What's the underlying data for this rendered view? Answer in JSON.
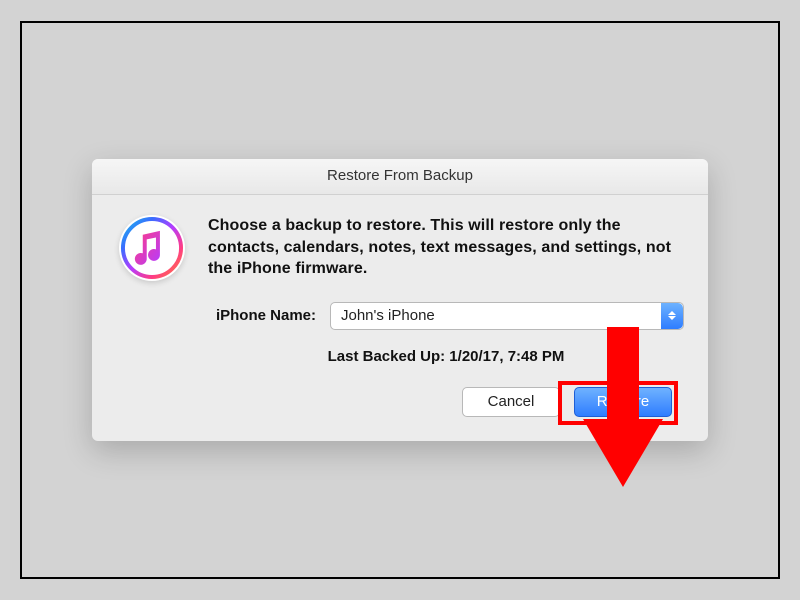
{
  "dialog": {
    "title": "Restore From Backup",
    "description": "Choose a backup to restore. This will restore only the contacts, calendars, notes, text messages, and settings, not the iPhone firmware.",
    "field_label": "iPhone Name:",
    "selected_device": "John's iPhone",
    "last_backup_label": "Last Backed Up: 1/20/17, 7:48 PM",
    "buttons": {
      "cancel": "Cancel",
      "restore": "Restore"
    }
  },
  "annotation": {
    "arrow_color": "#ff0000",
    "highlight_target": "restore-button"
  },
  "colors": {
    "primary_blue_top": "#6fb2ff",
    "primary_blue_bottom": "#2f7dff",
    "dialog_bg": "#ececec",
    "outer_bg": "#d3d3d3"
  }
}
